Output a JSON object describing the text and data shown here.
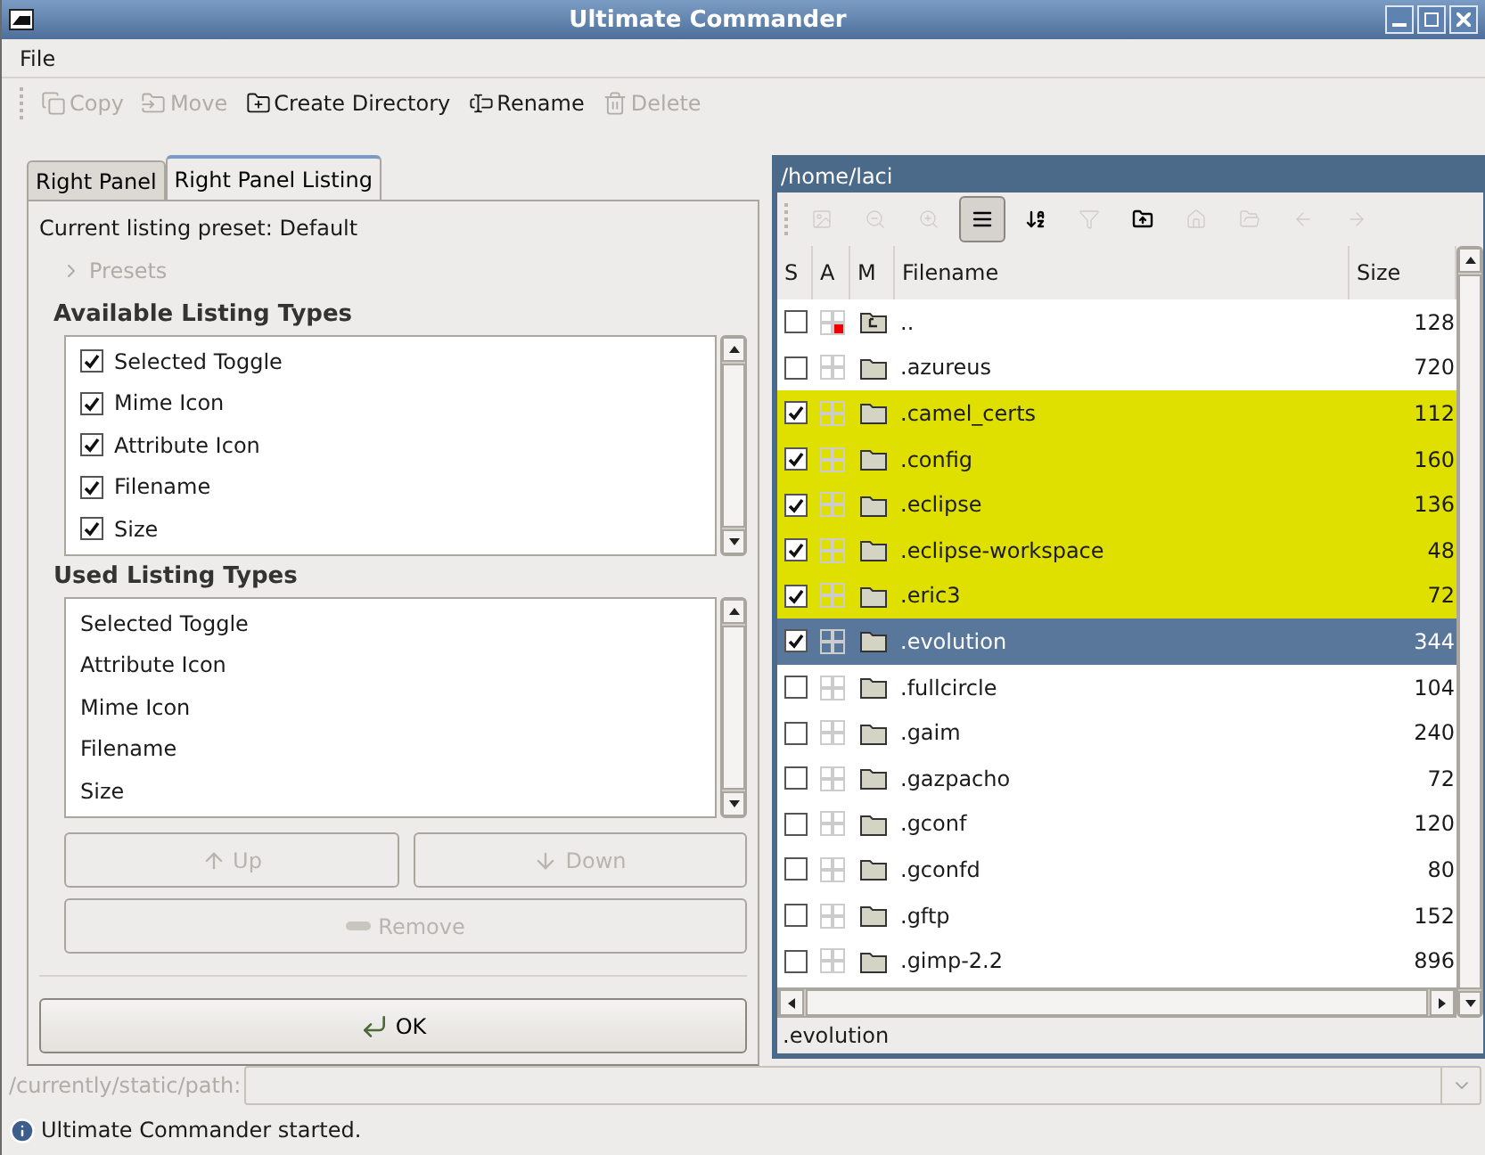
{
  "window": {
    "title": "Ultimate Commander"
  },
  "menu": [
    {
      "label": "File"
    }
  ],
  "toolbar": [
    {
      "kind": "copy",
      "label": "Copy",
      "disabled": true
    },
    {
      "kind": "move",
      "label": "Move",
      "disabled": true
    },
    {
      "kind": "mkdir",
      "label": "Create Directory",
      "disabled": false
    },
    {
      "kind": "rename",
      "label": "Rename",
      "disabled": false
    },
    {
      "kind": "delete",
      "label": "Delete",
      "disabled": true
    }
  ],
  "left_panel": {
    "tabs": [
      {
        "label": "Right Panel",
        "selected": false
      },
      {
        "label": "Right Panel Listing",
        "selected": true
      }
    ],
    "preset_label": "Current listing preset: Default",
    "presets": {
      "label": "Presets",
      "expanded": false,
      "disabled": true
    },
    "available": {
      "heading": "Available Listing Types",
      "items": [
        {
          "label": "Selected Toggle",
          "checked": true
        },
        {
          "label": "Mime Icon",
          "checked": true
        },
        {
          "label": "Attribute Icon",
          "checked": true
        },
        {
          "label": "Filename",
          "checked": true
        },
        {
          "label": "Size",
          "checked": true
        }
      ]
    },
    "used": {
      "heading": "Used Listing Types",
      "items": [
        "Selected Toggle",
        "Attribute Icon",
        "Mime Icon",
        "Filename",
        "Size"
      ]
    },
    "buttons": [
      {
        "kind": "up",
        "label": "Up",
        "disabled": true
      },
      {
        "kind": "down",
        "label": "Down",
        "disabled": true
      },
      {
        "kind": "remove",
        "label": "Remove",
        "disabled": true
      }
    ],
    "ok": {
      "label": "OK"
    }
  },
  "right_panel": {
    "path": "/home/laci",
    "tools": [
      {
        "kind": "image",
        "pressed": false,
        "disabled": true
      },
      {
        "kind": "zoom-out",
        "pressed": false,
        "disabled": true
      },
      {
        "kind": "zoom-in",
        "pressed": false,
        "disabled": true
      },
      {
        "kind": "list",
        "pressed": true,
        "disabled": false
      },
      {
        "kind": "sort",
        "pressed": false,
        "disabled": false
      },
      {
        "kind": "filter",
        "pressed": false,
        "disabled": true
      },
      {
        "kind": "parent",
        "pressed": false,
        "disabled": false
      },
      {
        "kind": "home",
        "pressed": false,
        "disabled": true
      },
      {
        "kind": "open",
        "pressed": false,
        "disabled": true
      },
      {
        "kind": "back",
        "pressed": false,
        "disabled": true
      },
      {
        "kind": "forward",
        "pressed": false,
        "disabled": true
      }
    ],
    "columns": [
      "S",
      "A",
      "M",
      "Filename",
      "Size"
    ],
    "rows": [
      {
        "kind": "parent",
        "name": "..",
        "size": "128",
        "checked": false,
        "selected": false
      },
      {
        "kind": "folder",
        "name": ".azureus",
        "size": "720",
        "checked": false,
        "selected": false
      },
      {
        "kind": "folder",
        "name": ".camel_certs",
        "size": "112",
        "checked": true,
        "selected": false
      },
      {
        "kind": "folder",
        "name": ".config",
        "size": "160",
        "checked": true,
        "selected": false
      },
      {
        "kind": "folder",
        "name": ".eclipse",
        "size": "136",
        "checked": true,
        "selected": false
      },
      {
        "kind": "folder",
        "name": ".eclipse-workspace",
        "size": "48",
        "checked": true,
        "selected": false
      },
      {
        "kind": "folder",
        "name": ".eric3",
        "size": "72",
        "checked": true,
        "selected": false
      },
      {
        "kind": "folder",
        "name": ".evolution",
        "size": "344",
        "checked": true,
        "selected": true
      },
      {
        "kind": "folder",
        "name": ".fullcircle",
        "size": "104",
        "checked": false,
        "selected": false
      },
      {
        "kind": "folder",
        "name": ".gaim",
        "size": "240",
        "checked": false,
        "selected": false
      },
      {
        "kind": "folder",
        "name": ".gazpacho",
        "size": "72",
        "checked": false,
        "selected": false
      },
      {
        "kind": "folder",
        "name": ".gconf",
        "size": "120",
        "checked": false,
        "selected": false
      },
      {
        "kind": "folder",
        "name": ".gconfd",
        "size": "80",
        "checked": false,
        "selected": false
      },
      {
        "kind": "folder",
        "name": ".gftp",
        "size": "152",
        "checked": false,
        "selected": false
      },
      {
        "kind": "folder",
        "name": ".gimp-2.2",
        "size": "896",
        "checked": false,
        "selected": false
      }
    ],
    "status": ".evolution"
  },
  "path_bar": {
    "label": "/currently/static/path:",
    "disabled": true
  },
  "status_bar": "Ultimate Commander started."
}
